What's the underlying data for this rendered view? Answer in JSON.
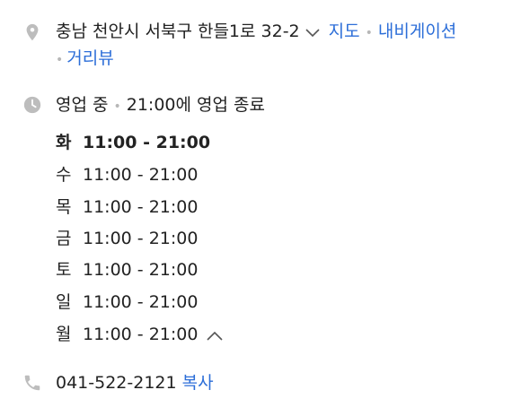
{
  "address": {
    "text": "충남 천안시 서북구 한들1로 32-2",
    "links": [
      "지도",
      "내비게이션",
      "거리뷰"
    ],
    "icon": "location-pin-icon"
  },
  "status": {
    "open_label": "영업 중",
    "close_info": "21:00에 영업 종료",
    "icon": "clock-icon"
  },
  "hours": [
    {
      "day": "화",
      "time": "11:00 - 21:00",
      "today": true
    },
    {
      "day": "수",
      "time": "11:00 - 21:00",
      "today": false
    },
    {
      "day": "목",
      "time": "11:00 - 21:00",
      "today": false
    },
    {
      "day": "금",
      "time": "11:00 - 21:00",
      "today": false
    },
    {
      "day": "토",
      "time": "11:00 - 21:00",
      "today": false
    },
    {
      "day": "일",
      "time": "11:00 - 21:00",
      "today": false
    },
    {
      "day": "월",
      "time": "11:00 - 21:00",
      "today": false
    }
  ],
  "phone": {
    "number": "041-522-2121",
    "copy_label": "복사",
    "icon": "phone-icon"
  },
  "colors": {
    "link": "#2c6ed8",
    "icon": "#bdbdbd",
    "text": "#222222"
  }
}
